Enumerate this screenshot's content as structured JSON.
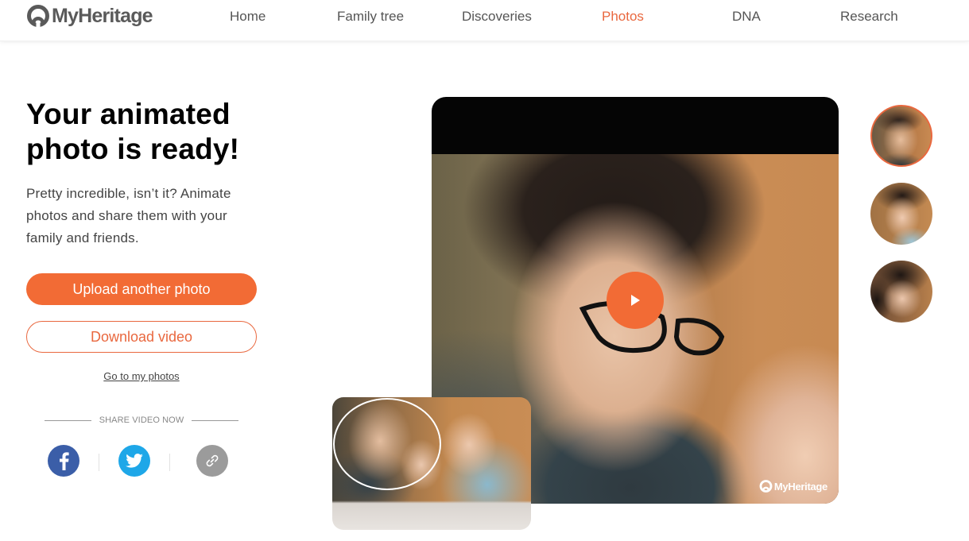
{
  "brand": {
    "name": "MyHeritage",
    "accent": "#f26b35",
    "accent_text": "#e9683f"
  },
  "nav": {
    "items": [
      {
        "label": "Home",
        "active": false
      },
      {
        "label": "Family tree",
        "active": false
      },
      {
        "label": "Discoveries",
        "active": false
      },
      {
        "label": "Photos",
        "active": true
      },
      {
        "label": "DNA",
        "active": false
      },
      {
        "label": "Research",
        "active": false
      }
    ]
  },
  "main": {
    "title_line1": "Your animated",
    "title_line2": "photo is ready!",
    "description": "Pretty incredible, isn’t it? Animate photos and share them with your family and friends.",
    "upload_button": "Upload another photo",
    "download_button": "Download video",
    "my_photos_link": "Go to my photos",
    "share_label": "SHARE VIDEO NOW",
    "share_buttons": [
      {
        "icon": "facebook-icon",
        "color": "#3b5ea8"
      },
      {
        "icon": "twitter-icon",
        "color": "#1ea7e8"
      },
      {
        "icon": "link-icon",
        "color": "#9b9b9b"
      }
    ]
  },
  "video": {
    "watermark": "MyHeritage",
    "play_icon": "play-icon"
  },
  "faces": [
    {
      "label": "face-man",
      "selected": true
    },
    {
      "label": "face-woman",
      "selected": false
    },
    {
      "label": "face-child",
      "selected": false
    }
  ]
}
